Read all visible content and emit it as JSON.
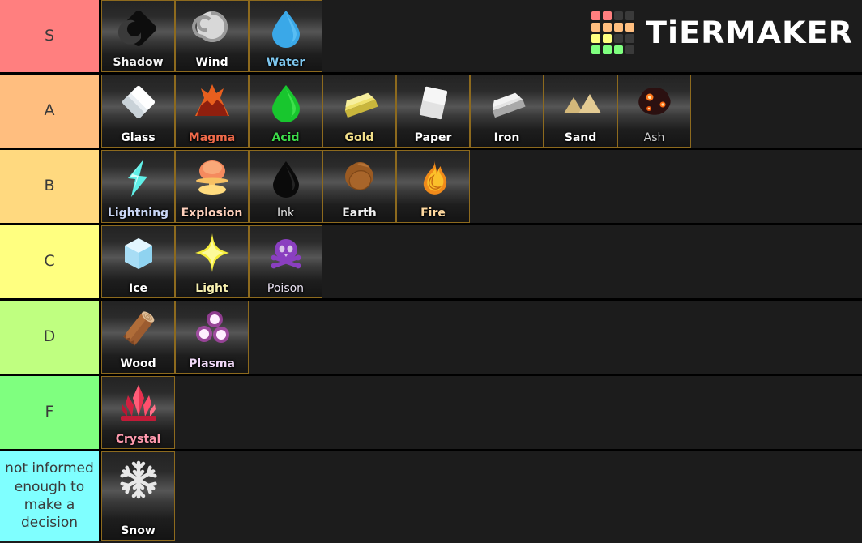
{
  "app": {
    "name": "TierMaker",
    "logo_word": "TiERMAKER",
    "logo_grid": [
      [
        "#ff7f7f",
        "#ff7f7f",
        "#3a3a3a",
        "#3a3a3a"
      ],
      [
        "#ffbe7f",
        "#ffbe7f",
        "#ffbe7f",
        "#ffbe7f"
      ],
      [
        "#ffff80",
        "#ffff80",
        "#3a3a3a",
        "#3a3a3a"
      ],
      [
        "#7fff7f",
        "#7fff7f",
        "#7fff7f",
        "#3a3a3a"
      ]
    ]
  },
  "colors": {
    "background": "#1c1c1c",
    "tile_border": "#8d6a1e",
    "row_divider": "#000000",
    "label_text": "#3a3a3a"
  },
  "tiers": [
    {
      "label": "S",
      "color": "#ff7f7f",
      "height": 92,
      "items": [
        {
          "name": "Shadow",
          "icon": "shadow-icon",
          "color": "#f2f2f2",
          "style": "bold"
        },
        {
          "name": "Wind",
          "icon": "wind-icon",
          "color": "#ffffff",
          "style": "bold"
        },
        {
          "name": "Water",
          "icon": "water-icon",
          "color": "#7ec8f0",
          "style": "bold"
        }
      ]
    },
    {
      "label": "A",
      "color": "#ffbe7f",
      "height": 93,
      "items": [
        {
          "name": "Glass",
          "icon": "glass-icon",
          "color": "#ffffff",
          "style": "bold"
        },
        {
          "name": "Magma",
          "icon": "magma-icon",
          "color": "#ef6a4a",
          "style": "bold"
        },
        {
          "name": "Acid",
          "icon": "acid-icon",
          "color": "#3ddc4a",
          "style": "bold"
        },
        {
          "name": "Gold",
          "icon": "gold-icon",
          "color": "#f3e08a",
          "style": "bold"
        },
        {
          "name": "Paper",
          "icon": "paper-icon",
          "color": "#ffffff",
          "style": "bold"
        },
        {
          "name": "Iron",
          "icon": "iron-icon",
          "color": "#ffffff",
          "style": "bold"
        },
        {
          "name": "Sand",
          "icon": "sand-icon",
          "color": "#ffffff",
          "style": "bold"
        },
        {
          "name": "Ash",
          "icon": "ash-icon",
          "color": "#cfcfcf",
          "style": "plain"
        }
      ]
    },
    {
      "label": "B",
      "color": "#ffd97f",
      "height": 93,
      "items": [
        {
          "name": "Lightning",
          "icon": "lightning-icon",
          "color": "#c9d6f5",
          "style": "bold"
        },
        {
          "name": "Explosion",
          "icon": "explosion-icon",
          "color": "#ffd1bd",
          "style": "bold"
        },
        {
          "name": "Ink",
          "icon": "ink-icon",
          "color": "#e8e8e8",
          "style": "plain"
        },
        {
          "name": "Earth",
          "icon": "earth-icon",
          "color": "#f0f0f0",
          "style": "bold"
        },
        {
          "name": "Fire",
          "icon": "fire-icon",
          "color": "#ffd9a0",
          "style": "bold"
        }
      ]
    },
    {
      "label": "C",
      "color": "#ffff80",
      "height": 93,
      "items": [
        {
          "name": "Ice",
          "icon": "ice-icon",
          "color": "#ffffff",
          "style": "bold"
        },
        {
          "name": "Light",
          "icon": "light-icon",
          "color": "#f7f0b0",
          "style": "bold"
        },
        {
          "name": "Poison",
          "icon": "poison-icon",
          "color": "#ece4f5",
          "style": "plain"
        }
      ]
    },
    {
      "label": "D",
      "color": "#bfff80",
      "height": 93,
      "items": [
        {
          "name": "Wood",
          "icon": "wood-icon",
          "color": "#ffffff",
          "style": "bold"
        },
        {
          "name": "Plasma",
          "icon": "plasma-icon",
          "color": "#f0d8f7",
          "style": "bold"
        }
      ]
    },
    {
      "label": "F",
      "color": "#7fff7f",
      "height": 93,
      "items": [
        {
          "name": "Crystal",
          "icon": "crystal-icon",
          "color": "#ff9aae",
          "style": "bold"
        }
      ]
    },
    {
      "label": "not informed enough to make a decision",
      "color": "#7fffff",
      "height": 110,
      "small": true,
      "items": [
        {
          "name": "Snow",
          "icon": "snow-icon",
          "color": "#ffffff",
          "style": "bold"
        }
      ]
    }
  ]
}
